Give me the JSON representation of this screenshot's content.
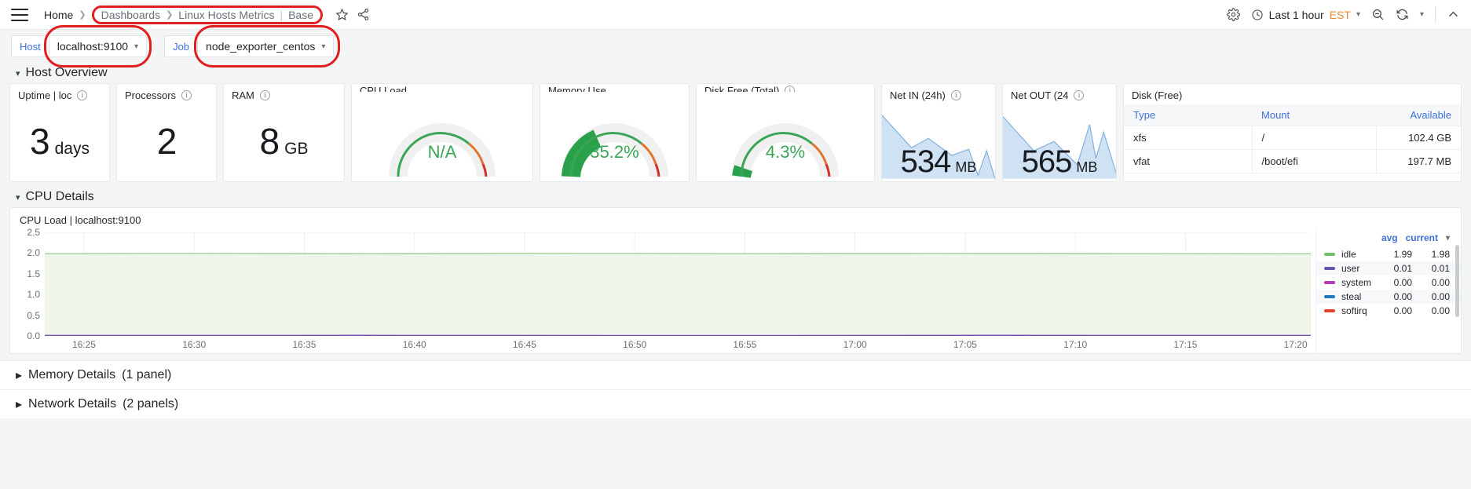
{
  "topbar": {
    "menu_icon": "hamburger-icon",
    "breadcrumbs": [
      {
        "label": "Home",
        "type": "link"
      },
      {
        "label": "Dashboards",
        "type": "link"
      },
      {
        "label": "Linux Hosts Metrics",
        "type": "link"
      },
      {
        "label": "Base",
        "type": "current"
      }
    ],
    "star_icon": "star-icon",
    "share_icon": "share-icon",
    "settings_icon": "gear-icon",
    "clock_icon": "clock-icon",
    "time_range": "Last 1 hour",
    "timezone": "EST",
    "zoom_out_icon": "zoom-out-icon",
    "refresh_icon": "refresh-icon",
    "collapse_icon": "chevron-up-icon"
  },
  "variables": [
    {
      "label": "Host",
      "value": "localhost:9100",
      "highlighted": true
    },
    {
      "label": "Job",
      "value": "node_exporter_centos",
      "highlighted": true
    }
  ],
  "rows": {
    "host_overview": {
      "label": "Host Overview",
      "expanded": true
    },
    "cpu_details": {
      "label": "CPU Details",
      "expanded": true
    },
    "memory_details": {
      "label": "Memory Details",
      "count": "(1 panel)",
      "expanded": false
    },
    "network_details": {
      "label": "Network Details",
      "count": "(2 panels)",
      "expanded": false
    }
  },
  "panels": {
    "uptime": {
      "title": "Uptime | loc",
      "has_info": true,
      "value": "3",
      "unit": "days"
    },
    "processors": {
      "title": "Processors",
      "has_info": true,
      "value": "2",
      "unit": ""
    },
    "ram": {
      "title": "RAM",
      "has_info": true,
      "value": "8",
      "unit": "GB"
    },
    "cpu_load": {
      "title": "CPU Load",
      "has_info": false,
      "value": "N/A",
      "percent": 0
    },
    "memory_use": {
      "title": "Memory Use",
      "has_info": false,
      "value": "35.2%",
      "percent": 35.2
    },
    "disk_free": {
      "title": "Disk Free (Total)",
      "has_info": true,
      "value": "4.3%",
      "percent": 4.3
    },
    "net_in": {
      "title": "Net IN (24h)",
      "has_info": true,
      "value": "534",
      "unit": "MB"
    },
    "net_out": {
      "title": "Net OUT (24",
      "has_info": true,
      "value": "565",
      "unit": "MB"
    },
    "disk_table": {
      "title": "Disk (Free)",
      "columns": [
        "Type",
        "Mount",
        "Available"
      ],
      "rows": [
        [
          "xfs",
          "/",
          "102.4 GB"
        ],
        [
          "vfat",
          "/boot/efi",
          "197.7 MB"
        ]
      ]
    }
  },
  "colors": {
    "gauge_green": "#3aa655",
    "gauge_orange": "#e0752d",
    "gauge_red": "#d4302b",
    "gauge_track": "#f0f0f0",
    "accent_blue": "#3d71d9",
    "highlight_red": "#e02020",
    "spark_fill": "#cfe2f3",
    "spark_line": "#5b9bd5"
  },
  "chart_data": {
    "type": "line",
    "title": "CPU Load | localhost:9100",
    "xlabel": "",
    "ylabel": "",
    "ylim": [
      0.0,
      2.5
    ],
    "yticks": [
      "0.0",
      "0.5",
      "1.0",
      "1.5",
      "2.0",
      "2.5"
    ],
    "xticks": [
      "16:25",
      "16:30",
      "16:35",
      "16:40",
      "16:45",
      "16:50",
      "16:55",
      "17:00",
      "17:05",
      "17:10",
      "17:15",
      "17:20"
    ],
    "grid": true,
    "legend_position": "right",
    "legend_columns": [
      "avg",
      "current"
    ],
    "series": [
      {
        "name": "idle",
        "color": "#73bf69",
        "avg": "1.99",
        "current": "1.98",
        "level": 1.99
      },
      {
        "name": "user",
        "color": "#6655aa",
        "avg": "0.01",
        "current": "0.01",
        "level": 0.01
      },
      {
        "name": "system",
        "color": "#b83ab8",
        "avg": "0.00",
        "current": "0.00",
        "level": 0.0
      },
      {
        "name": "steal",
        "color": "#1f78c1",
        "avg": "0.00",
        "current": "0.00",
        "level": 0.0
      },
      {
        "name": "softirq",
        "color": "#e0452c",
        "avg": "0.00",
        "current": "0.00",
        "level": 0.0
      }
    ]
  }
}
